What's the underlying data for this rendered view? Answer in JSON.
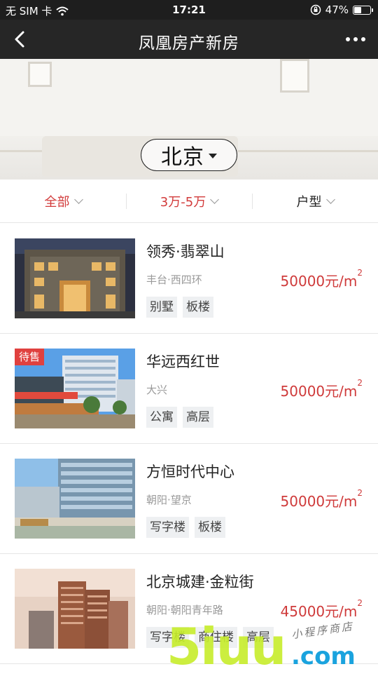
{
  "status_bar": {
    "carrier": "无 SIM 卡",
    "time": "17:21",
    "battery": "47%",
    "battery_level": 0.47
  },
  "nav": {
    "title": "凤凰房产新房",
    "back_icon": "chevron-left-icon",
    "more_icon": "more-dots-icon"
  },
  "hero": {
    "city": "北京"
  },
  "filters": [
    {
      "label": "全部",
      "active": true
    },
    {
      "label": "3万-5万",
      "active": true
    },
    {
      "label": "户型",
      "active": false
    }
  ],
  "listings": [
    {
      "name": "领秀·翡翠山",
      "location": "丰台·西四环",
      "price": "50000元/m",
      "price_unit_sup": "2",
      "tags": [
        "别墅",
        "板楼"
      ],
      "badge": ""
    },
    {
      "name": "华远西红世",
      "location": "大兴",
      "price": "50000元/m",
      "price_unit_sup": "2",
      "tags": [
        "公寓",
        "高层"
      ],
      "badge": "待售"
    },
    {
      "name": "方恒时代中心",
      "location": "朝阳·望京",
      "price": "50000元/m",
      "price_unit_sup": "2",
      "tags": [
        "写字楼",
        "板楼"
      ],
      "badge": ""
    },
    {
      "name": "北京城建·金粒街",
      "location": "朝阳·朝阳青年路",
      "price": "45000元/m",
      "price_unit_sup": "2",
      "tags": [
        "写字楼",
        "商住楼",
        "高层"
      ],
      "badge": ""
    }
  ],
  "watermark": {
    "logo": "5iuu",
    "domain": ".com",
    "tagline": "小程序商店"
  },
  "colors": {
    "accent_red": "#cf3a3a",
    "nav_bg": "#262626"
  }
}
